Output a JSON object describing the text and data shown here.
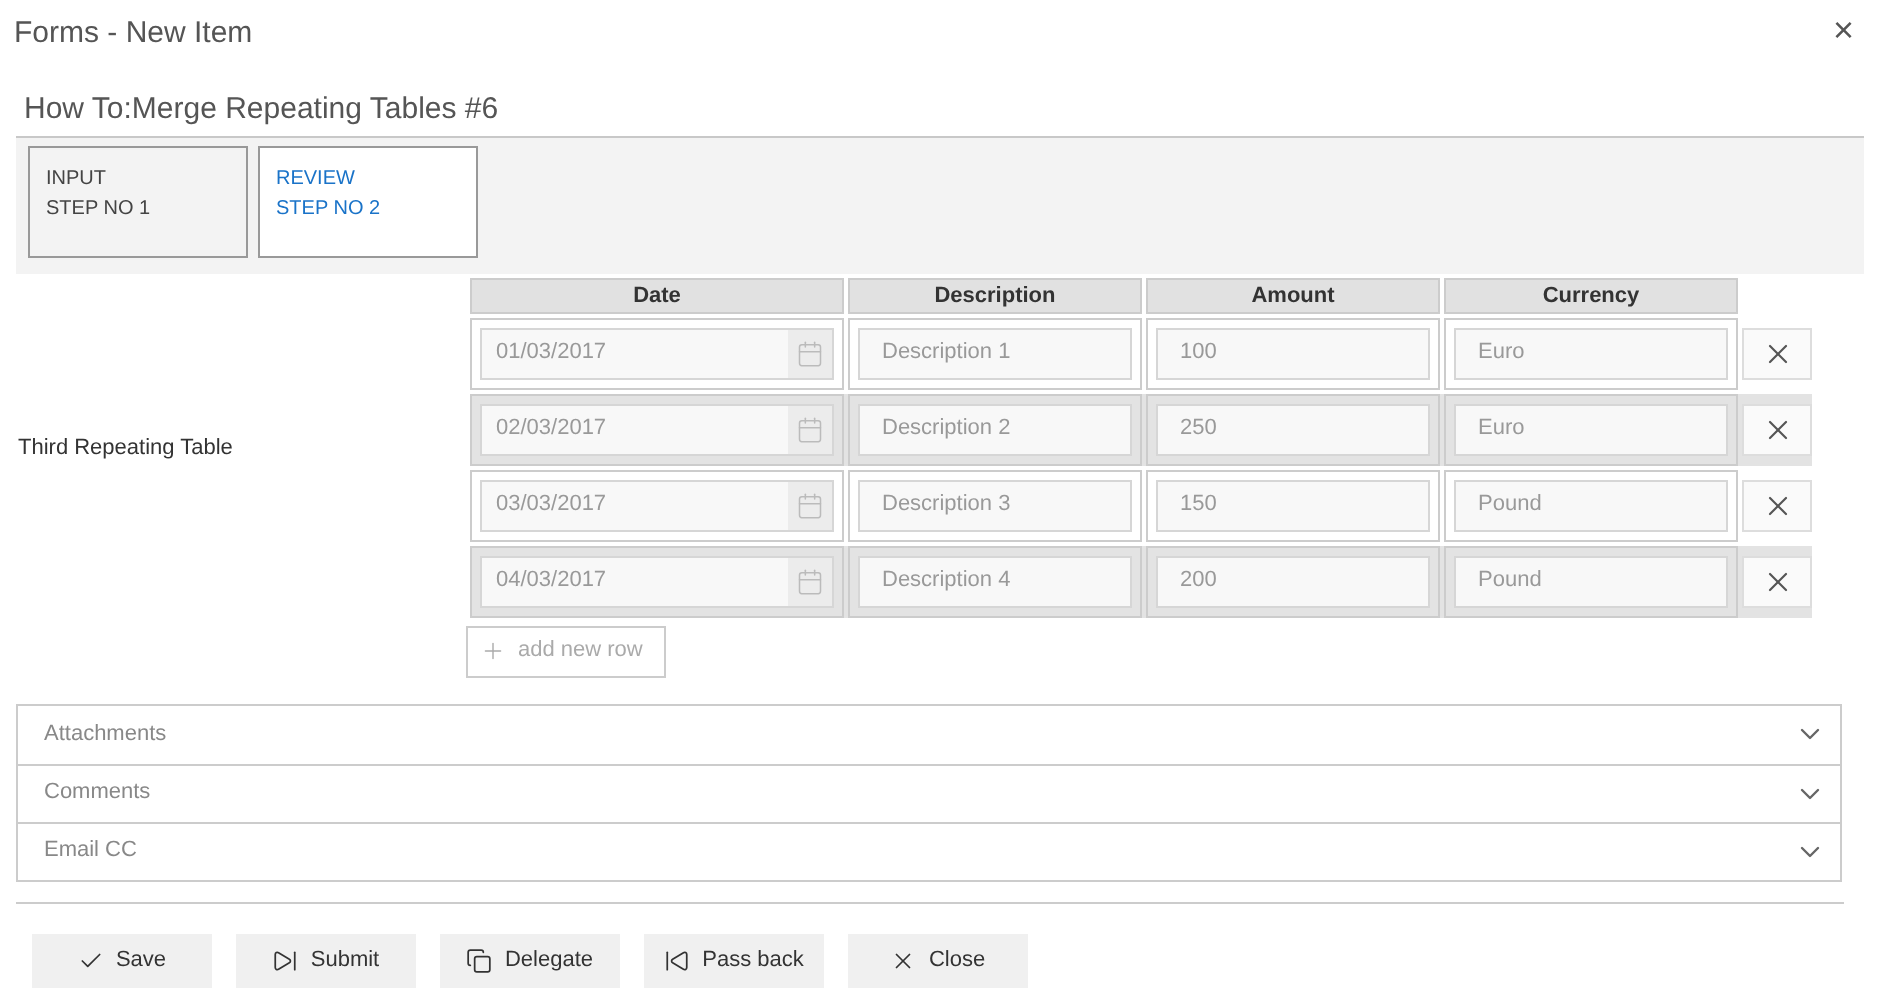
{
  "window": {
    "title": "Forms - New Item",
    "close": "×"
  },
  "form_title": "How To:Merge Repeating Tables #6",
  "steps": [
    {
      "name": "INPUT",
      "step": "STEP NO 1",
      "selected": false
    },
    {
      "name": "REVIEW",
      "step": "STEP NO 2",
      "selected": true
    }
  ],
  "table_label": "Third Repeating Table",
  "table": {
    "columns": [
      "Date",
      "Description",
      "Amount",
      "Currency"
    ],
    "rows": [
      [
        "01/03/2017",
        "Description 1",
        "100",
        "Euro"
      ],
      [
        "02/03/2017",
        "Description 2",
        "250",
        "Euro"
      ],
      [
        "03/03/2017",
        "Description 3",
        "150",
        "Pound"
      ],
      [
        "04/03/2017",
        "Description 4",
        "200",
        "Pound"
      ]
    ],
    "add_row": "add new row"
  },
  "sections": [
    {
      "label": "Attachments",
      "expanded": false
    },
    {
      "label": "Comments",
      "expanded": false
    },
    {
      "label": "Email CC",
      "expanded": false
    }
  ],
  "buttons": [
    {
      "label": "Save",
      "kind": "save"
    },
    {
      "label": "Submit",
      "kind": "submit"
    },
    {
      "label": "Delegate",
      "kind": "delegate"
    },
    {
      "label": "Pass back",
      "kind": "passback"
    },
    {
      "label": "Close",
      "kind": "close"
    }
  ]
}
